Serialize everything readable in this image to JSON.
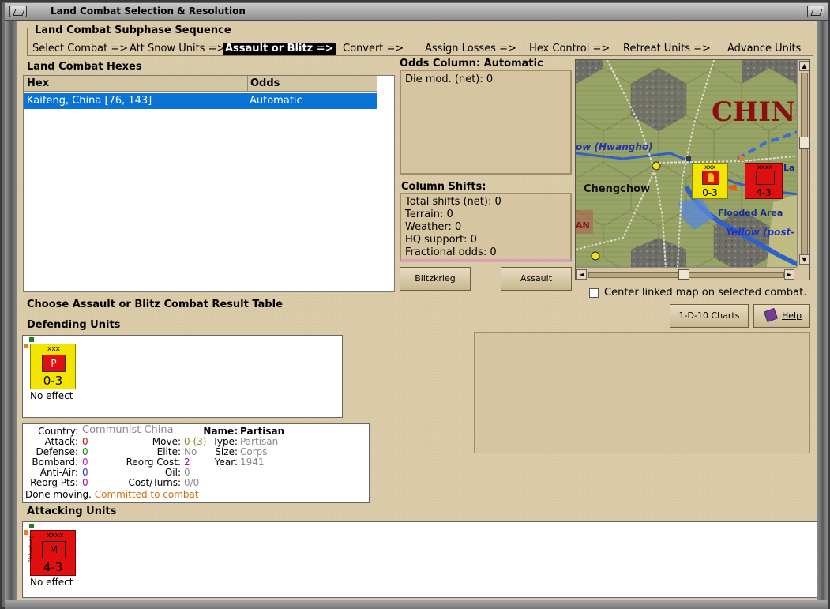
{
  "window": {
    "title": "Land Combat Selection & Resolution"
  },
  "subphase": {
    "title": "Land Combat Subphase Sequence",
    "steps": [
      "Select Combat =>",
      "Att Snow Units =>",
      "Assault or Blitz =>",
      "Convert =>",
      "Assign Losses =>",
      "Hex Control =>",
      "Retreat Units =>",
      "Advance Units"
    ],
    "active_index": 2
  },
  "hexes": {
    "title": "Land Combat Hexes",
    "columns": [
      "Hex",
      "Odds"
    ],
    "rows": [
      {
        "hex": "Kaifeng, China [76, 143]",
        "odds": "Automatic"
      }
    ]
  },
  "odds": {
    "title": "Odds Column: Automatic",
    "die_mod": "Die mod. (net): 0"
  },
  "shifts": {
    "title": "Column Shifts:",
    "lines": [
      "Total shifts (net): 0",
      "Terrain: 0",
      "Weather: 0",
      "HQ support: 0",
      "Fractional odds: 0"
    ]
  },
  "buttons": {
    "blitzkrieg": "Blitzkrieg",
    "assault": "Assault",
    "charts": "1-D-10 Charts",
    "help": "Help"
  },
  "map": {
    "labels": {
      "country": "CHIN",
      "river": "ow (Hwangho)",
      "city": "Chengchow",
      "flooded": "Flooded Area",
      "yellow": "Yellow (post-",
      "la": "La",
      "an": "AN"
    },
    "defender_counter": {
      "size": "xxx",
      "strength": "0-3"
    },
    "attacker_counter": {
      "size": "xxxx",
      "strength": "4-3"
    }
  },
  "center_linked": {
    "label": "Center linked map on selected combat.",
    "checked": false
  },
  "choose_label": "Choose Assault or Blitz Combat Result Table",
  "defending": {
    "title": "Defending Units",
    "units": [
      {
        "size": "xxx",
        "type_letter": "P",
        "strength": "0-3",
        "result": "No effect",
        "color": "#f2e600"
      }
    ]
  },
  "unit_info": {
    "country_label": "Country:",
    "country": "Communist China",
    "attack_label": "Attack:",
    "attack": "0",
    "defense_label": "Defense:",
    "defense": "0",
    "bombard_label": "Bombard:",
    "bombard": "0",
    "antiair_label": "Anti-Air:",
    "antiair": "0",
    "reorgpts_label": "Reorg Pts:",
    "reorgpts": "0",
    "move_label": "Move:",
    "move": "0",
    "move_extra": "(3)",
    "elite_label": "Elite:",
    "elite": "No",
    "reorgcost_label": "Reorg Cost:",
    "reorgcost": "2",
    "oil_label": "Oil:",
    "oil": "0",
    "costturns_label": "Cost/Turns:",
    "costturns": "0/0",
    "name_label": "Name:",
    "name": "Partisan",
    "type_label": "Type:",
    "type": "Partisan",
    "size_label": "Size:",
    "size": "Corps",
    "year_label": "Year:",
    "year": "1941",
    "status": "Done moving.",
    "status_detail": "Committed to combat"
  },
  "attacking": {
    "title": "Attacking Units",
    "units": [
      {
        "size": "xxxx",
        "type_letter": "M",
        "side_text": "Pinkushang",
        "strength": "4-3",
        "result": "No effect",
        "color": "#e01010"
      }
    ]
  }
}
